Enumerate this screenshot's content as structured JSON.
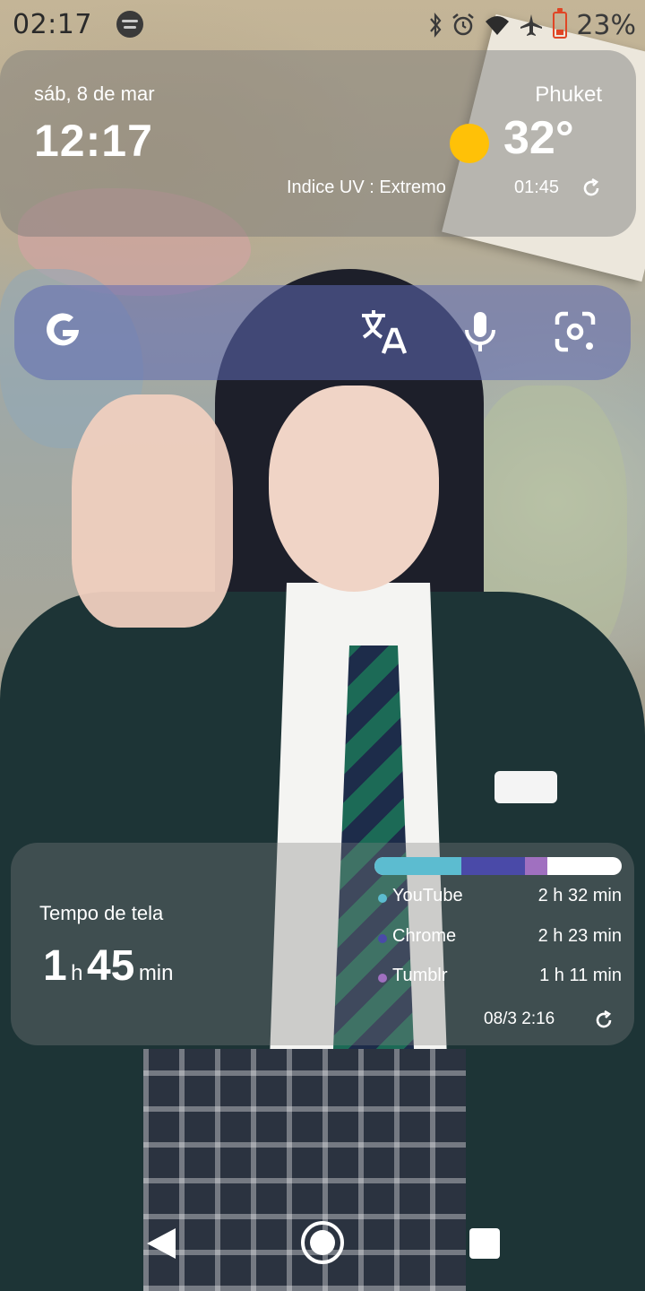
{
  "status_bar": {
    "time": "02:17",
    "battery_percent": "23%",
    "battery_level": 0.23,
    "icons": [
      "spotify-icon",
      "bluetooth-icon",
      "alarm-icon",
      "wifi-icon",
      "airplane-icon",
      "battery-icon"
    ]
  },
  "weather_widget": {
    "date": "sáb, 8 de mar",
    "time": "12:17",
    "city": "Phuket",
    "temperature": "32°",
    "uv_index": "Indice UV : Extremo",
    "updated": "01:45",
    "sun_color": "#ffc107"
  },
  "search_bar": {
    "icons": [
      "google-logo-icon",
      "translate-icon",
      "microphone-icon",
      "lens-camera-icon"
    ]
  },
  "screen_time": {
    "title": "Tempo de tela",
    "total_hours": "1",
    "hours_unit": "h",
    "total_minutes": "45",
    "minutes_unit": "min",
    "apps": [
      {
        "name": "YouTube",
        "duration": "2 h 32 min",
        "color": "#5cbcd0",
        "share": 0.35
      },
      {
        "name": "Chrome",
        "duration": "2 h 23 min",
        "color": "#4a4aa8",
        "share": 0.26
      },
      {
        "name": "Tumblr",
        "duration": "1 h 11 min",
        "color": "#a070c0",
        "share": 0.09
      }
    ],
    "updated": "08/3 2:16"
  },
  "navigation_bar": {
    "buttons": [
      "back-button",
      "home-button",
      "recents-button"
    ]
  }
}
